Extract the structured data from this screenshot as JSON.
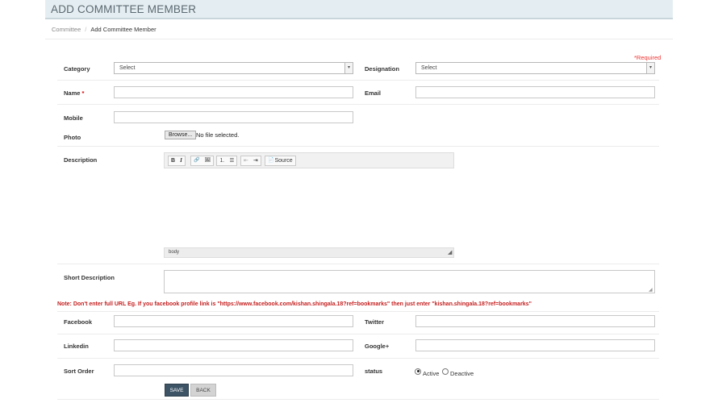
{
  "header": {
    "title": "ADD COMMITTEE MEMBER"
  },
  "breadcrumb": {
    "parent": "Committee",
    "separator": "/",
    "current": "Add Committee Member"
  },
  "form": {
    "required_note": "*Required",
    "category": {
      "label": "Category",
      "value": "Select"
    },
    "designation": {
      "label": "Designation",
      "value": "Select"
    },
    "name": {
      "label": "Name",
      "star": "*",
      "value": ""
    },
    "email": {
      "label": "Email",
      "value": ""
    },
    "mobile": {
      "label": "Mobile",
      "value": ""
    },
    "photo": {
      "label": "Photo",
      "browse": "Browse...",
      "status": "No file selected."
    },
    "description": {
      "label": "Description",
      "toolbar": {
        "bold": "B",
        "italic": "I",
        "link": "🔗",
        "image": "🖼",
        "ol": "⒈",
        "ul": "☰",
        "outdent": "⇤",
        "indent": "⇥",
        "source_icon": "📄",
        "source": "Source"
      },
      "statusbar": "body",
      "resize": "◢"
    },
    "short_description": {
      "label": "Short Description",
      "value": ""
    },
    "note": "Note: Don't enter full URL Eg. If you facebook profile link is \"https://www.facebook.com/kishan.shingala.18?ref=bookmarks\" then just enter \"kishan.shingala.18?ref=bookmarks\"",
    "facebook": {
      "label": "Facebook",
      "value": ""
    },
    "twitter": {
      "label": "Twitter",
      "value": ""
    },
    "linkedin": {
      "label": "Linkedin",
      "value": ""
    },
    "googleplus": {
      "label": "Google+",
      "value": ""
    },
    "sort_order": {
      "label": "Sort Order",
      "value": ""
    },
    "status": {
      "label": "status",
      "active": "Active",
      "deactive": "Deactive",
      "selected": "Active"
    }
  },
  "buttons": {
    "save": "SAVE",
    "back": "BACK"
  }
}
